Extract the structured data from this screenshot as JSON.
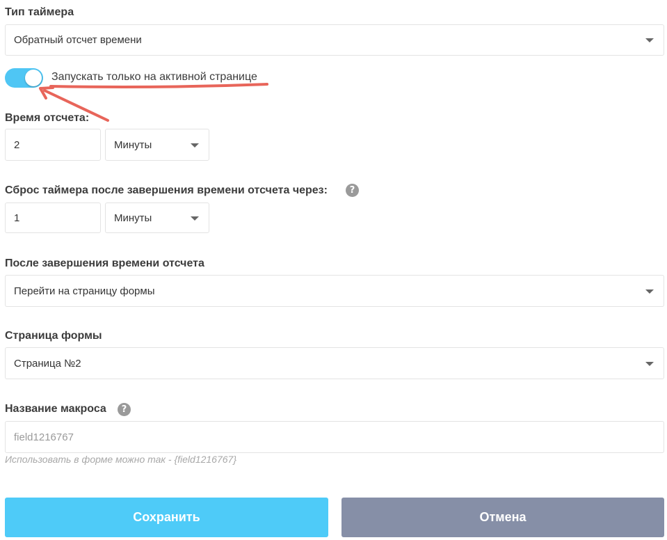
{
  "timer_type": {
    "label": "Тип таймера",
    "value": "Обратный отсчет времени"
  },
  "active_page_toggle": {
    "label": "Запускать только на активной странице",
    "checked": true,
    "accent": "#4fc6f4"
  },
  "countdown": {
    "label": "Время отсчета:",
    "value": "2",
    "unit": "Минуты"
  },
  "reset": {
    "label": "Сброс таймера после завершения времени отсчета через:",
    "value": "1",
    "unit": "Минуты"
  },
  "after_finish": {
    "label": "После завершения времени отсчета",
    "value": "Перейти на страницу формы"
  },
  "form_page": {
    "label": "Страница формы",
    "value": "Страница №2"
  },
  "macro": {
    "label": "Название макроса",
    "placeholder": "field1216767",
    "hint": "Использовать в форме можно так - {field1216767}"
  },
  "buttons": {
    "save": "Сохранить",
    "cancel": "Отмена",
    "save_color": "#4ecbf8",
    "cancel_color": "#868fa7"
  },
  "annotation_color": "#e8655a"
}
